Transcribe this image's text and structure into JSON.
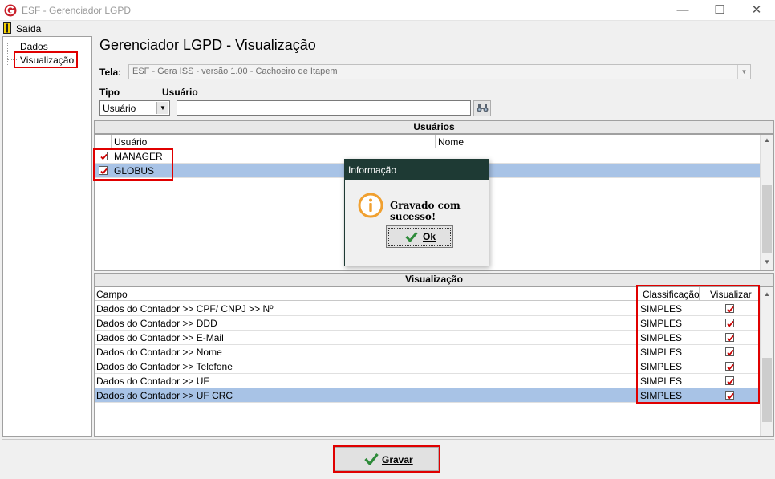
{
  "window": {
    "title": "ESF - Gerenciador LGPD",
    "minimize_glyph": "—",
    "maximize_glyph": "☐",
    "close_glyph": "✕"
  },
  "menu": {
    "exit_label": "Saída"
  },
  "tree": {
    "items": [
      "Dados",
      "Visualização"
    ]
  },
  "header": {
    "title": "Gerenciador LGPD - Visualização",
    "tela_label": "Tela:",
    "tela_value": "ESF - Gera ISS - versão 1.00 - Cachoeiro de Itapem",
    "tipo_label": "Tipo",
    "usuario_label": "Usuário",
    "tipo_value": "Usuário",
    "usuario_value": ""
  },
  "users_panel": {
    "title": "Usuários",
    "columns": [
      "Usuário",
      "Nome"
    ],
    "rows": [
      {
        "user": "MANAGER",
        "name": "",
        "checked": true
      },
      {
        "user": "GLOBUS",
        "name": "",
        "checked": true,
        "selected": true
      }
    ]
  },
  "view_panel": {
    "title": "Visualização",
    "columns": [
      "Campo",
      "Classificação",
      "Visualizar"
    ],
    "rows": [
      {
        "campo": "Dados do Contador >> CPF/ CNPJ >> Nº",
        "classificacao": "SIMPLES",
        "visualizar": true
      },
      {
        "campo": "Dados do Contador >> DDD",
        "classificacao": "SIMPLES",
        "visualizar": true
      },
      {
        "campo": "Dados do Contador >> E-Mail",
        "classificacao": "SIMPLES",
        "visualizar": true
      },
      {
        "campo": "Dados do Contador >> Nome",
        "classificacao": "SIMPLES",
        "visualizar": true
      },
      {
        "campo": "Dados do Contador >> Telefone",
        "classificacao": "SIMPLES",
        "visualizar": true
      },
      {
        "campo": "Dados do Contador >> UF",
        "classificacao": "SIMPLES",
        "visualizar": true
      },
      {
        "campo": "Dados do Contador >> UF CRC",
        "classificacao": "SIMPLES",
        "visualizar": true,
        "selected": true
      }
    ]
  },
  "dialog": {
    "title": "Informação",
    "message": "Gravado com sucesso!",
    "ok_label": "Ok"
  },
  "footer": {
    "save_label": "Gravar"
  },
  "colors": {
    "highlight_red": "#e00000",
    "selection": "#a8c3e6",
    "dialog_title_bg": "#1e3a34",
    "check_red": "#cc0000",
    "ok_green": "#2e8b3a",
    "info_orange": "#f0a030"
  }
}
